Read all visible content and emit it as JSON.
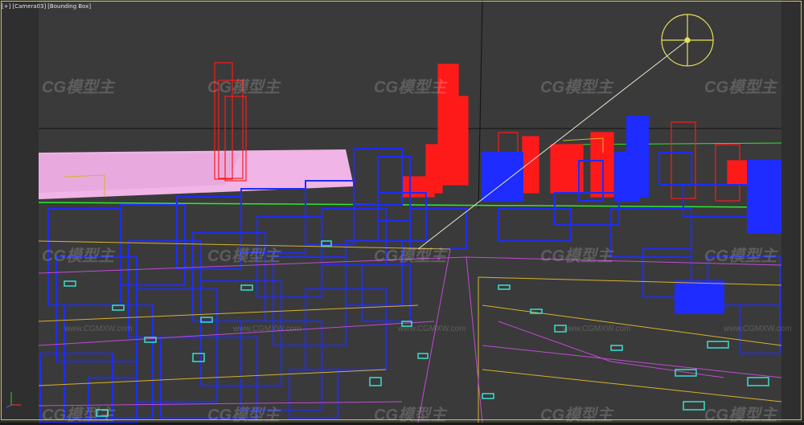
{
  "viewport": {
    "plus_label": "+",
    "bracket_open": "[",
    "bracket_close": "]",
    "camera_label": "[Camera03]",
    "shading_label": "[Bounding Box]"
  },
  "axis": {
    "x_label": "x",
    "y_label": "y",
    "z_label": "z"
  },
  "watermarks": {
    "logo_text": "CG模型主",
    "url_text": "www.CGMXW.com"
  },
  "colors": {
    "background": "#3a3a3a",
    "frame": "#cfc35a",
    "blue_objects": "#1e2cff",
    "red_objects": "#ff1a1a",
    "pink_ground": "#f0b4e6",
    "cyan_detail": "#38e0d0",
    "yellow_lines": "#d6b12e",
    "magenta_lines": "#c24ad6",
    "green_lines": "#2ee82e",
    "light_gizmo": "#e8e05a"
  }
}
